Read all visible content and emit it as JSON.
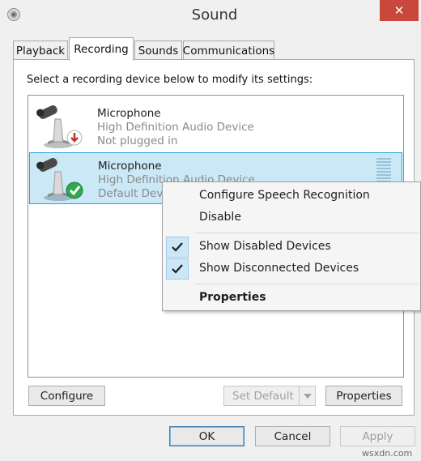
{
  "window": {
    "title": "Sound",
    "close_label": "✕"
  },
  "tabs": [
    {
      "label": "Playback"
    },
    {
      "label": "Recording"
    },
    {
      "label": "Sounds"
    },
    {
      "label": "Communications"
    }
  ],
  "instruction": "Select a recording device below to modify its settings:",
  "devices": [
    {
      "name": "Microphone",
      "detail": "High Definition Audio Device",
      "status": "Not plugged in"
    },
    {
      "name": "Microphone",
      "detail": "High Definition Audio Device",
      "status": "Default Device"
    }
  ],
  "context_menu": {
    "items": [
      {
        "label": "Configure Speech Recognition",
        "checked": false
      },
      {
        "label": "Disable",
        "checked": false
      },
      {
        "label": "Show Disabled Devices",
        "checked": true
      },
      {
        "label": "Show Disconnected Devices",
        "checked": true
      },
      {
        "label": "Properties",
        "checked": false
      }
    ]
  },
  "panel_buttons": {
    "configure": "Configure",
    "set_default": "Set Default",
    "properties": "Properties"
  },
  "dialog_buttons": {
    "ok": "OK",
    "cancel": "Cancel",
    "apply": "Apply"
  },
  "watermark": "wsxdn.com",
  "colors": {
    "close_button": "#c9473b",
    "selection_fill": "#cbe8f6",
    "selection_border": "#26a0da",
    "check_green": "#2fa84f",
    "unplugged_red": "#c0392b"
  }
}
